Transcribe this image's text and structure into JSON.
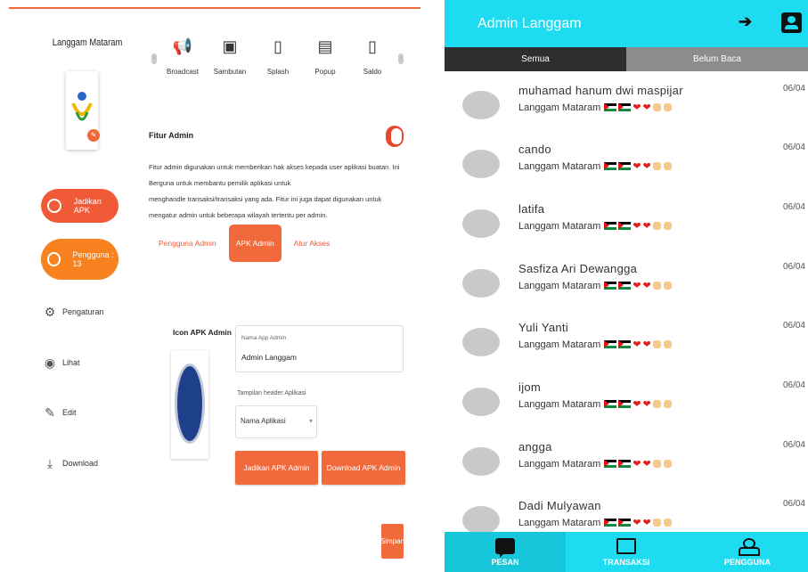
{
  "left": {
    "app_name": "Langgam Mataram",
    "menu": {
      "jadikan_apk": "Jadikan APK",
      "pengguna": "Pengguna : 13",
      "items": [
        {
          "label": "Pengaturan",
          "icon": "gear-icon"
        },
        {
          "label": "Lihat",
          "icon": "eye-icon"
        },
        {
          "label": "Edit",
          "icon": "pencil-icon"
        },
        {
          "label": "Download",
          "icon": "download-icon"
        }
      ]
    },
    "features": [
      {
        "label": "Broadcast",
        "icon": "megaphone-icon"
      },
      {
        "label": "Sambutan",
        "icon": "welcome-sign-icon"
      },
      {
        "label": "Splash",
        "icon": "phone-splash-icon"
      },
      {
        "label": "Popup",
        "icon": "popup-icon"
      },
      {
        "label": "Saldo",
        "icon": "wallet-phone-icon"
      }
    ],
    "fitur_title": "Fitur Admin",
    "fitur_toggle_on": true,
    "fitur_desc_1": "Fitur admin digunakan untuk memberikan hak akses kepada user aplikasi buatan. Ini Berguna untuk membantu pemilik aplikasi untuk",
    "fitur_desc_2": "menghandle transaksi/transaksi yang ada. Fitur ini juga dapat digunakan untuk mengatur admin untuk beberapa wilayah tertentu per admin.",
    "tabs": [
      "Pengguna Admin",
      "APK Admin",
      "Atur Akses"
    ],
    "active_tab": "APK Admin",
    "icon_label": "Icon APK Admin",
    "name_field_label": "Nama App Admin",
    "name_field_value": "Admin Langgam",
    "header_label": "Tampilan header Aplikasi",
    "header_select_value": "Nama Aplikasi",
    "btn_jadikan": "Jadikan APK Admin",
    "btn_download": "Download APK Admin",
    "btn_save": "Simpan",
    "accent": "#f26a3b"
  },
  "right": {
    "title": "Admin Langgam",
    "segments": [
      "Semua",
      "Belum Baca"
    ],
    "active_segment": "Semua",
    "chats": [
      {
        "name": "muhamad hanum dwi maspijar",
        "sub": "Langgam Mataram",
        "date": "06/04"
      },
      {
        "name": "cando",
        "sub": "Langgam Mataram",
        "date": "06/04"
      },
      {
        "name": "latifa",
        "sub": "Langgam Mataram",
        "date": "06/04"
      },
      {
        "name": "Sasfiza Ari Dewangga",
        "sub": "Langgam Mataram",
        "date": "06/04"
      },
      {
        "name": "Yuli Yanti",
        "sub": "Langgam Mataram",
        "date": "06/04"
      },
      {
        "name": "ijom",
        "sub": "Langgam Mataram",
        "date": "06/04"
      },
      {
        "name": "angga",
        "sub": "Langgam Mataram",
        "date": "06/04"
      },
      {
        "name": "Dadi Mulyawan",
        "sub": "Langgam Mataram",
        "date": "06/04"
      }
    ],
    "nav": [
      {
        "label": "PESAN",
        "icon": "message-icon"
      },
      {
        "label": "TRANSAKSI",
        "icon": "ticket-icon"
      },
      {
        "label": "PENGGUNA",
        "icon": "users-icon"
      }
    ],
    "active_nav": "PESAN",
    "accent": "#1ddbf0"
  }
}
